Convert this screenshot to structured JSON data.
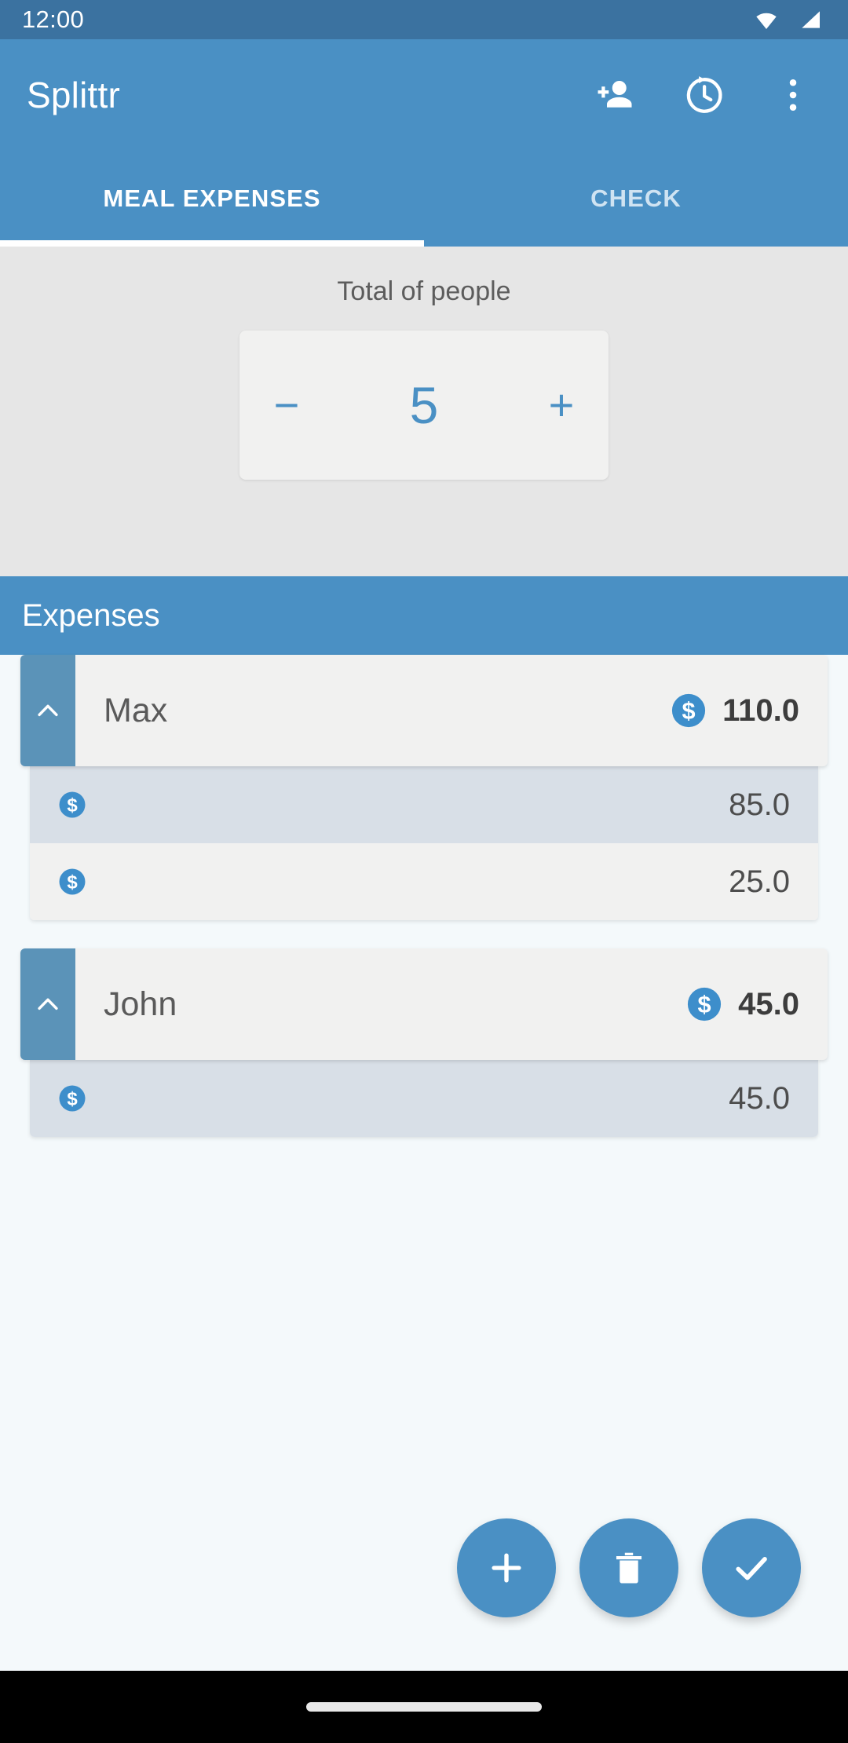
{
  "status_bar": {
    "time": "12:00",
    "icons": [
      "wifi-icon",
      "cellular-signal-icon"
    ]
  },
  "app_bar": {
    "title": "Splittr",
    "actions": [
      {
        "name": "add-person-icon",
        "label": "Add person"
      },
      {
        "name": "history-icon",
        "label": "History"
      },
      {
        "name": "overflow-menu-icon",
        "label": "More options"
      }
    ]
  },
  "tabs": {
    "items": [
      {
        "label": "MEAL EXPENSES",
        "active": true
      },
      {
        "label": "CHECK",
        "active": false
      }
    ]
  },
  "counter": {
    "label": "Total of people",
    "decrement_label": "−",
    "value": "5",
    "increment_label": "+"
  },
  "section": {
    "title": "Expenses"
  },
  "expense_groups": [
    {
      "name": "Max",
      "total": "110.0",
      "expanded": true,
      "items": [
        {
          "amount": "85.0"
        },
        {
          "amount": "25.0"
        }
      ]
    },
    {
      "name": "John",
      "total": "45.0",
      "expanded": true,
      "items": [
        {
          "amount": "45.0"
        }
      ]
    }
  ],
  "fabs": [
    {
      "name": "add-expense-fab",
      "icon": "plus-icon",
      "label": "Add"
    },
    {
      "name": "delete-fab",
      "icon": "trash-icon",
      "label": "Delete"
    },
    {
      "name": "confirm-fab",
      "icon": "check-icon",
      "label": "Confirm"
    }
  ],
  "colors": {
    "status_bar": "#3b72a0",
    "primary": "#4a90c4",
    "handle": "#5b93b8",
    "panel_bg": "#e6e6e6",
    "card_bg": "#f1f1f0",
    "sub_row_alt": "#d8dfe7",
    "page_bg": "#f4f9fb"
  }
}
